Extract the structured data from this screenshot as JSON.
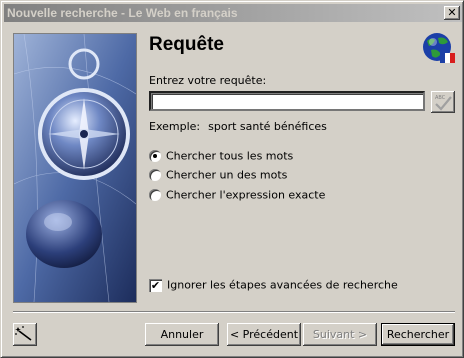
{
  "window": {
    "title": "Nouvelle recherche - Le Web en français",
    "close_glyph": "✕"
  },
  "header": {
    "title": "Requête",
    "globe_icon": "globe-flag-icon"
  },
  "query": {
    "label": "Entrez votre requête:",
    "value": "",
    "placeholder": ""
  },
  "example": {
    "label": "Exemple:",
    "value": "sport santé bénéfices"
  },
  "options": [
    {
      "label": "Chercher tous les mots",
      "checked": true
    },
    {
      "label": "Chercher un des mots",
      "checked": false
    },
    {
      "label": "Chercher l'expression exacte",
      "checked": false
    }
  ],
  "skip_advanced": {
    "label": "Ignorer les étapes avancées de recherche",
    "checked": true,
    "check_glyph": "✔"
  },
  "buttons": {
    "cancel": "Annuler",
    "previous": "< Précédent",
    "next": "Suivant >",
    "search": "Rechercher"
  },
  "colors": {
    "dialog": "#d4d0c8",
    "title_gradient_start": "#808080",
    "title_gradient_end": "#c0c0c0"
  }
}
